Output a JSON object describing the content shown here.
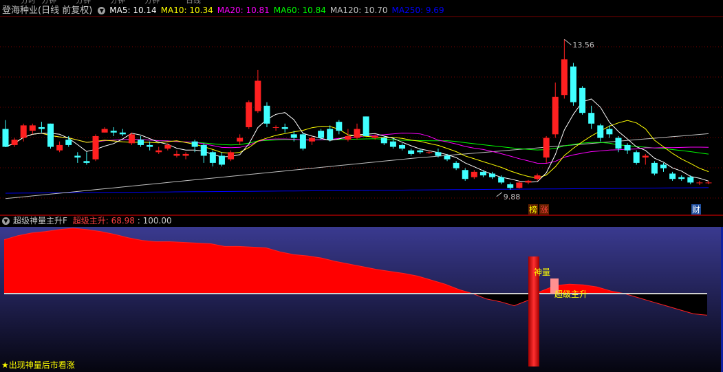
{
  "header": {
    "title": "登海种业(日线 前复权)",
    "ma": [
      {
        "label": "MA5: 10.14",
        "color": "#ffffff"
      },
      {
        "label": "MA10: 10.34",
        "color": "#ffff00"
      },
      {
        "label": "MA20: 10.81",
        "color": "#ff00ff"
      },
      {
        "label": "MA60: 10.84",
        "color": "#00ff00"
      },
      {
        "label": "MA120: 10.70",
        "color": "#c0c0c0"
      },
      {
        "label": "MA250: 9.69",
        "color": "#0000ff"
      }
    ]
  },
  "indicator": {
    "name": "超级神量主升F",
    "value_label": "超级主升: 68.98",
    "value2": ": 100.00",
    "label_shenliang": "神量",
    "label_zhusheng": "超级主升",
    "footer": "★出现神量后市看涨"
  },
  "badges": [
    {
      "text": "榜",
      "color": "#ffff00"
    },
    {
      "text": "涨",
      "color": "#ff4040"
    },
    {
      "text": "财",
      "color": "#ffffff"
    }
  ],
  "colors": {
    "up": "#ff2020",
    "down": "#40ffff",
    "grid": "#7a0000",
    "ma5": "#ffffff",
    "ma10": "#ffff00",
    "ma20": "#ff00ff",
    "ma60": "#00ff00",
    "ma120": "#c0c0c0",
    "ma250": "#0000ff"
  },
  "chart_data": [
    {
      "type": "candlestick",
      "annotations": [
        {
          "text": "13.56",
          "kind": "high"
        },
        {
          "text": "9.88",
          "kind": "low"
        }
      ],
      "ylim": [
        9.0,
        14.2
      ],
      "candles": [
        [
          11.05,
          10.55,
          11.3,
          10.55
        ],
        [
          10.6,
          10.75,
          10.8,
          10.55
        ],
        [
          10.8,
          11.15,
          11.2,
          10.7
        ],
        [
          11.0,
          11.15,
          11.2,
          10.9
        ],
        [
          11.1,
          11.05,
          11.25,
          10.95
        ],
        [
          11.2,
          10.55,
          11.2,
          10.5
        ],
        [
          10.45,
          10.6,
          10.7,
          10.4
        ],
        [
          10.75,
          10.6,
          10.85,
          10.55
        ],
        [
          10.3,
          10.25,
          10.4,
          10.1
        ],
        [
          10.15,
          10.1,
          10.4,
          10.05
        ],
        [
          10.2,
          10.85,
          10.9,
          10.15
        ],
        [
          10.95,
          11.05,
          11.1,
          10.95
        ],
        [
          11.0,
          10.95,
          11.1,
          10.85
        ],
        [
          10.95,
          10.9,
          11.05,
          10.85
        ],
        [
          10.65,
          10.9,
          10.95,
          10.6
        ],
        [
          10.75,
          10.6,
          10.85,
          10.55
        ],
        [
          10.6,
          10.55,
          10.7,
          10.45
        ],
        [
          10.4,
          10.45,
          10.55,
          10.35
        ],
        [
          10.5,
          10.6,
          10.65,
          10.45
        ],
        [
          10.3,
          10.35,
          10.45,
          10.25
        ],
        [
          10.3,
          10.35,
          10.4,
          10.2
        ],
        [
          10.7,
          10.55,
          10.75,
          10.4
        ],
        [
          10.6,
          10.3,
          10.65,
          10.1
        ],
        [
          10.4,
          10.1,
          10.45,
          10.0
        ],
        [
          10.3,
          10.05,
          10.4,
          10.0
        ],
        [
          10.2,
          10.4,
          10.45,
          10.15
        ],
        [
          10.7,
          10.8,
          10.9,
          10.6
        ],
        [
          11.1,
          11.8,
          11.85,
          11.05
        ],
        [
          11.55,
          12.4,
          12.7,
          11.5
        ],
        [
          11.7,
          11.2,
          11.8,
          11.1
        ],
        [
          11.1,
          11.1,
          11.15,
          11.0
        ],
        [
          11.1,
          11.05,
          11.2,
          10.95
        ],
        [
          10.9,
          10.8,
          11.0,
          10.7
        ],
        [
          10.9,
          10.5,
          10.95,
          10.45
        ],
        [
          10.7,
          10.8,
          10.85,
          10.6
        ],
        [
          11.0,
          10.8,
          11.05,
          10.75
        ],
        [
          11.05,
          10.75,
          11.15,
          10.7
        ],
        [
          11.25,
          11.0,
          11.3,
          10.9
        ],
        [
          10.75,
          10.85,
          11.05,
          10.7
        ],
        [
          10.8,
          11.05,
          11.2,
          10.75
        ],
        [
          11.4,
          10.85,
          11.4,
          10.85
        ],
        [
          10.8,
          10.85,
          10.9,
          10.75
        ],
        [
          10.8,
          10.65,
          10.85,
          10.6
        ],
        [
          10.7,
          10.55,
          10.8,
          10.5
        ],
        [
          10.6,
          10.5,
          10.65,
          10.45
        ],
        [
          10.45,
          10.35,
          10.5,
          10.3
        ],
        [
          10.45,
          10.4,
          10.5,
          10.35
        ],
        [
          10.4,
          10.4,
          10.45,
          10.35
        ],
        [
          10.4,
          10.3,
          10.5,
          10.25
        ],
        [
          10.3,
          10.2,
          10.35,
          10.15
        ],
        [
          10.1,
          9.95,
          10.15,
          9.9
        ],
        [
          9.9,
          9.65,
          9.95,
          9.6
        ],
        [
          9.7,
          9.85,
          9.9,
          9.65
        ],
        [
          9.85,
          9.75,
          9.9,
          9.7
        ],
        [
          9.8,
          9.7,
          9.85,
          9.65
        ],
        [
          9.7,
          9.55,
          9.75,
          9.5
        ],
        [
          9.5,
          9.4,
          9.55,
          9.35
        ],
        [
          9.4,
          9.55,
          9.6,
          9.38
        ],
        [
          9.55,
          9.6,
          9.62,
          9.5
        ],
        [
          9.65,
          9.75,
          9.8,
          9.6
        ],
        [
          10.25,
          10.8,
          10.85,
          10.1
        ],
        [
          10.9,
          11.95,
          12.35,
          10.8
        ],
        [
          12.0,
          13.0,
          13.56,
          11.9
        ],
        [
          12.8,
          11.8,
          12.9,
          11.7
        ],
        [
          12.2,
          11.5,
          12.25,
          11.45
        ],
        [
          11.5,
          11.2,
          11.7,
          11.05
        ],
        [
          11.15,
          10.8,
          11.2,
          10.7
        ],
        [
          11.05,
          10.9,
          11.15,
          10.8
        ],
        [
          10.8,
          10.5,
          10.85,
          10.4
        ],
        [
          10.6,
          10.45,
          10.65,
          10.35
        ],
        [
          10.4,
          10.1,
          10.45,
          10.05
        ],
        [
          10.25,
          10.3,
          10.35,
          10.05
        ],
        [
          10.1,
          9.8,
          10.15,
          9.75
        ],
        [
          10.05,
          9.95,
          10.1,
          9.85
        ],
        [
          9.8,
          9.65,
          9.85,
          9.6
        ],
        [
          9.7,
          9.65,
          9.75,
          9.6
        ],
        [
          9.7,
          9.55,
          9.75,
          9.5
        ],
        [
          9.55,
          9.55,
          9.6,
          9.48
        ],
        [
          9.55,
          9.55,
          9.6,
          9.5
        ]
      ]
    },
    {
      "type": "area",
      "series": [
        {
          "name": "超级主升",
          "values": [
            80,
            86,
            90,
            92,
            95,
            97,
            95,
            92,
            88,
            83,
            79,
            77,
            77,
            76,
            75,
            74,
            70,
            70,
            69,
            68,
            62,
            58,
            56,
            53,
            48,
            44,
            40,
            36,
            33,
            30,
            26,
            20,
            14,
            6,
            0,
            -8,
            -12,
            -18,
            -10,
            4,
            12,
            14,
            13,
            10,
            4,
            0,
            -6,
            -12,
            -18,
            -24,
            -30,
            -32
          ]
        }
      ],
      "ylim": [
        -100,
        100
      ]
    }
  ]
}
